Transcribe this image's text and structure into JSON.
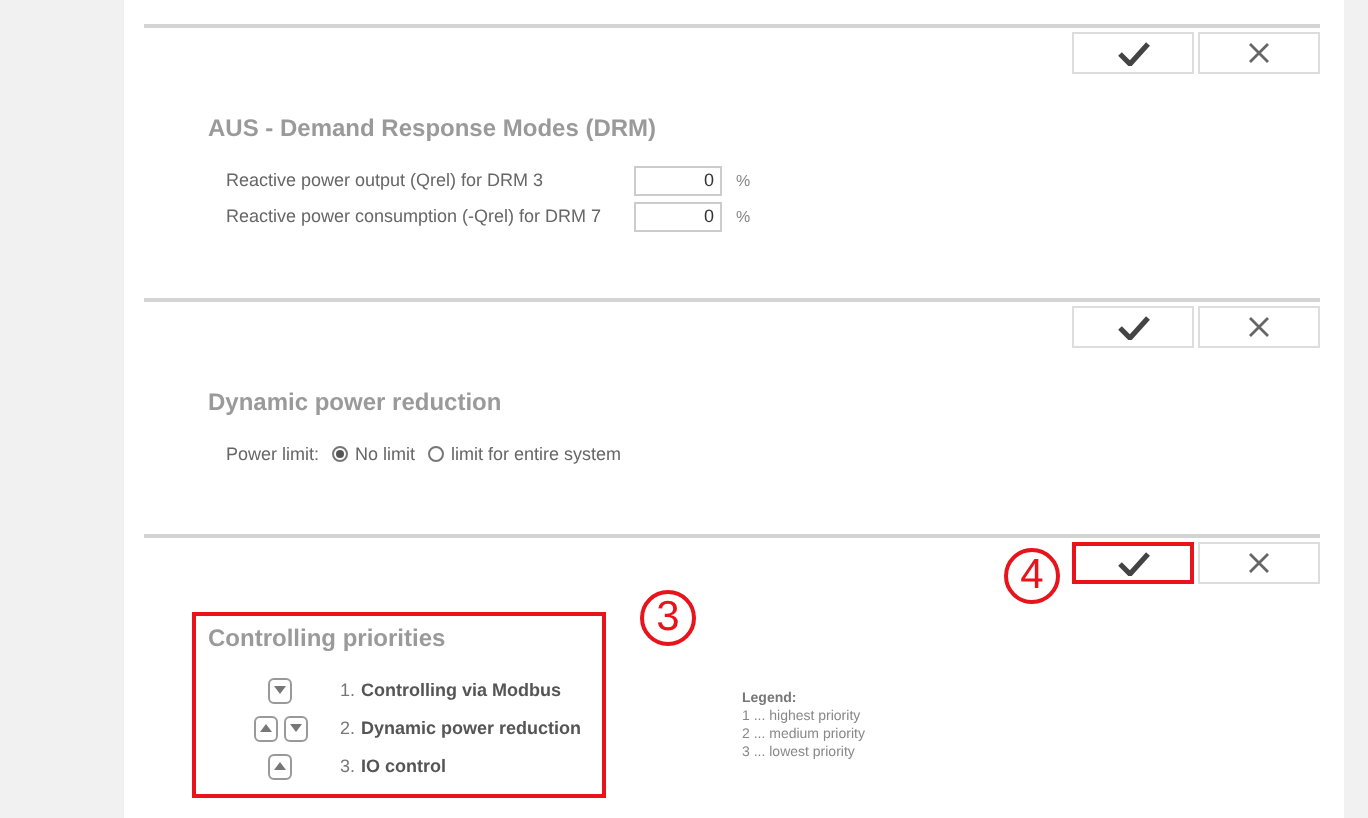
{
  "sections": [
    {
      "kind": "drm",
      "title": "AUS - Demand Response Modes (DRM)",
      "confirm_highlighted": false,
      "fields": [
        {
          "label": "Reactive power output (Qrel) for DRM 3",
          "value": "0",
          "unit": "%"
        },
        {
          "label": "Reactive power consumption (-Qrel) for DRM 7",
          "value": "0",
          "unit": "%"
        }
      ]
    },
    {
      "kind": "power",
      "title": "Dynamic power reduction",
      "confirm_highlighted": false,
      "label": "Power limit:",
      "options": [
        {
          "label": "No limit",
          "selected": true
        },
        {
          "label": "limit for entire system",
          "selected": false
        }
      ]
    },
    {
      "kind": "priorities",
      "title": "Controlling priorities",
      "confirm_highlighted": true,
      "confirm_marker": "4",
      "highlighted": true,
      "marker": "3",
      "items": [
        {
          "number": "1.",
          "label": "Controlling via Modbus",
          "can_move_up": false,
          "can_move_down": true
        },
        {
          "number": "2.",
          "label": "Dynamic power reduction",
          "can_move_up": true,
          "can_move_down": true
        },
        {
          "number": "3.",
          "label": "IO control",
          "can_move_up": true,
          "can_move_down": false
        }
      ],
      "legend": {
        "title": "Legend:",
        "lines": [
          "1 ... highest priority",
          "2 ... medium priority",
          "3 ... lowest priority"
        ]
      }
    }
  ]
}
